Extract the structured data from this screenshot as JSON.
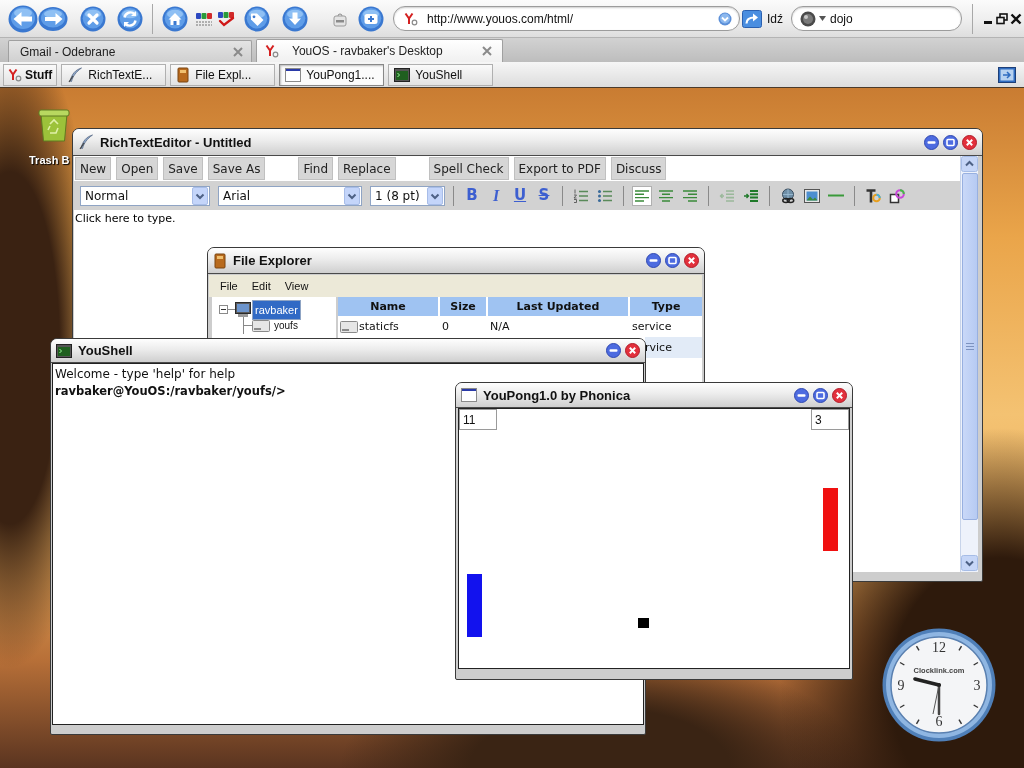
{
  "browser": {
    "toolbar": {
      "buttons": [
        {
          "kind": "back"
        },
        {
          "kind": "forward"
        },
        {
          "kind": "stop"
        },
        {
          "kind": "reload"
        },
        {
          "kind": "home"
        },
        {
          "kind": "web-spell"
        },
        {
          "kind": "spell-check"
        },
        {
          "kind": "tag"
        },
        {
          "kind": "download"
        },
        {
          "kind": "tag-small"
        },
        {
          "kind": "add"
        }
      ],
      "address": "http://www.youos.com/html/",
      "go_label": "Idź",
      "search_value": "dojo"
    },
    "tabs": [
      {
        "label": "Gmail - Odebrane",
        "selected": false
      },
      {
        "label": "YouOS - ravbaker's Desktop",
        "selected": true
      }
    ]
  },
  "taskbar": {
    "start_label": "Stuff",
    "items": [
      {
        "kind": "editor",
        "label": "RichTextE...",
        "selected": false
      },
      {
        "kind": "explorer",
        "label": "File Expl...",
        "selected": false
      },
      {
        "kind": "pong",
        "label": "YouPong1....",
        "selected": true
      },
      {
        "kind": "shell",
        "label": "YouShell",
        "selected": false
      }
    ]
  },
  "desktop": {
    "icons": [
      {
        "label": "Trash B"
      }
    ]
  },
  "windows": [
    {
      "kind": "editor",
      "title": "RichTextEditor - Untitled",
      "controls": [
        {
          "kind": "minimize"
        },
        {
          "kind": "maximize"
        },
        {
          "kind": "close"
        }
      ],
      "menu_buttons": [
        [
          "New",
          "Open",
          "Save",
          "Save As"
        ],
        [
          "Find",
          "Replace"
        ],
        [
          "Spell Check",
          "Export to PDF",
          "Discuss"
        ]
      ],
      "selects": [
        "Normal",
        "Arial",
        "1 (8 pt)"
      ],
      "tool_groups": [
        [
          {
            "kind": "bold",
            "label": "B",
            "selected": false
          },
          {
            "kind": "italic",
            "label": "I",
            "selected": false
          },
          {
            "kind": "underline",
            "label": "U",
            "selected": false
          },
          {
            "kind": "strike",
            "label": "S",
            "selected": false
          }
        ],
        [
          {
            "kind": "ordered-list",
            "selected": false
          },
          {
            "kind": "bullet-list",
            "selected": false
          }
        ],
        [
          {
            "kind": "align-left",
            "selected": true
          },
          {
            "kind": "align-center",
            "selected": false
          },
          {
            "kind": "align-right",
            "selected": false
          }
        ],
        [
          {
            "kind": "outdent",
            "selected": false
          },
          {
            "kind": "indent",
            "selected": false
          }
        ],
        [
          {
            "kind": "link",
            "selected": false
          },
          {
            "kind": "image",
            "selected": false
          },
          {
            "kind": "rule",
            "selected": false
          }
        ],
        [
          {
            "kind": "text-color",
            "selected": false
          },
          {
            "kind": "back-color",
            "selected": false
          }
        ]
      ],
      "body_text": "Click here to type."
    },
    {
      "kind": "explorer",
      "title": "File Explorer",
      "controls": [
        {
          "kind": "minimize"
        },
        {
          "kind": "maximize"
        },
        {
          "kind": "close"
        }
      ],
      "menu": [
        "File",
        "Edit",
        "View"
      ],
      "tree": [
        {
          "label": "ravbaker",
          "selected": true,
          "expanded": true,
          "children": [
            {
              "label": "youfs",
              "selected": false
            }
          ]
        }
      ],
      "table": {
        "columns": [
          "Name",
          "Size",
          "Last Updated",
          "Type"
        ],
        "rows": [
          {
            "name": "staticfs",
            "size": "0",
            "last_updated": "N/A",
            "type": "service"
          },
          {
            "type": "rvice"
          }
        ]
      }
    },
    {
      "kind": "shell",
      "title": "YouShell",
      "controls": [
        {
          "kind": "minimize"
        },
        {
          "kind": "close"
        }
      ],
      "lines": [
        {
          "kind": "output",
          "text": "Welcome - type 'help' for help"
        },
        {
          "kind": "prompt",
          "text": "ravbaker@YouOS:/ravbaker/youfs/>"
        }
      ]
    },
    {
      "kind": "pong",
      "title": "YouPong1.0 by Phonica",
      "controls": [
        {
          "kind": "minimize"
        },
        {
          "kind": "maximize"
        },
        {
          "kind": "close"
        }
      ],
      "scores": [
        "11",
        "3"
      ]
    }
  ],
  "clock": {
    "numerals": [
      "12",
      "3",
      "6",
      "9"
    ],
    "brand": "Clocklink.com"
  }
}
